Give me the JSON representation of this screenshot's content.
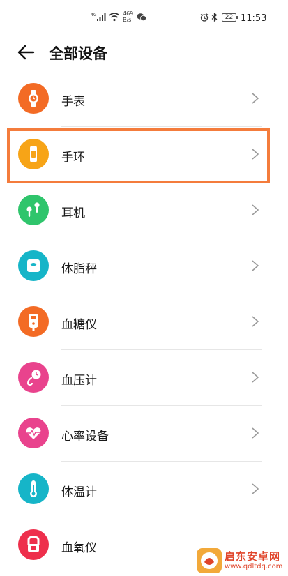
{
  "status_bar": {
    "network_type": "4G",
    "speed_value": "469",
    "speed_unit": "B/s",
    "battery": "22",
    "time": "11:53"
  },
  "header": {
    "title": "全部设备",
    "back_icon": "back-arrow-icon"
  },
  "devices": [
    {
      "label": "手表",
      "icon": "watch-icon",
      "color": "#f36b25"
    },
    {
      "label": "手环",
      "icon": "band-icon",
      "color": "#f7a417"
    },
    {
      "label": "耳机",
      "icon": "earphones-icon",
      "color": "#2fc56c"
    },
    {
      "label": "体脂秤",
      "icon": "scale-icon",
      "color": "#16b5c8"
    },
    {
      "label": "血糖仪",
      "icon": "glucose-meter-icon",
      "color": "#f36b25"
    },
    {
      "label": "血压计",
      "icon": "blood-pressure-icon",
      "color": "#e9438d"
    },
    {
      "label": "心率设备",
      "icon": "heart-rate-icon",
      "color": "#e9438d"
    },
    {
      "label": "体温计",
      "icon": "thermometer-icon",
      "color": "#16b5c8"
    },
    {
      "label": "血氧仪",
      "icon": "oximeter-icon",
      "color": "#ee2f4c"
    }
  ],
  "highlight": {
    "color": "#f47c3c",
    "target": "手环"
  },
  "watermark": {
    "name": "启东安卓网",
    "url": "www.qdltdq.com",
    "color": "#e0442a"
  }
}
